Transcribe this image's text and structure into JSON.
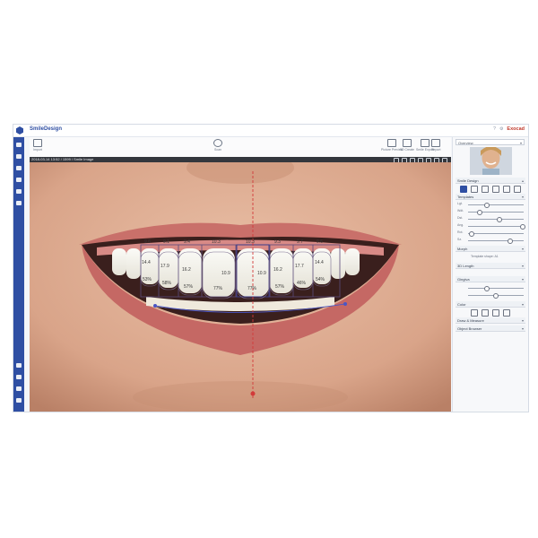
{
  "app": {
    "title": "SmileDesign",
    "brand": "Exocad",
    "window_controls": [
      "?",
      "⚙"
    ]
  },
  "toolbar": {
    "left_tool": "Import",
    "center_tool": "Scan",
    "right_tools": [
      "Picture Preview",
      "3D Create",
      "Smile Export",
      "Report",
      "Export"
    ]
  },
  "image": {
    "title": "2018-03-14 13:52 / 1599 / Smile Image"
  },
  "leftnav": {
    "top_icons": [
      "patient-icon",
      "card-icon",
      "mail-icon",
      "camera-icon",
      "info-icon",
      "tooth-icon"
    ],
    "bottom_icons": [
      "brush-icon",
      "shape-icon",
      "settings-icon",
      "help-icon"
    ]
  },
  "teeth": {
    "widths": [
      "9.6",
      "9.1",
      "9.4",
      "10.3",
      "10.3",
      "9.3",
      "9.7",
      "9.6"
    ],
    "lengths": [
      "14.4",
      "17.9",
      "16.2",
      "10.9",
      "10.9",
      "16.2",
      "17.7",
      "14.4"
    ],
    "ratios": [
      "53%",
      "58%",
      "57%",
      "77%",
      "77%",
      "57%",
      "46%",
      "54%"
    ]
  },
  "rpanel": {
    "dropdown": "Overview",
    "smile_design": "Smile Design",
    "section_templates": "Templates",
    "section_morph": "Morph",
    "section_length": "3D Length",
    "section_gingiva": "Gingiva",
    "section_color": "Color",
    "section_draw": "Draw & Measure",
    "section_objects": "Object Browser",
    "template_note": "Template shape: A1",
    "slider_labels": [
      "Lgt.",
      "Wdt.",
      "Dst.",
      "Ang.",
      "Rot.",
      "Sz."
    ]
  }
}
